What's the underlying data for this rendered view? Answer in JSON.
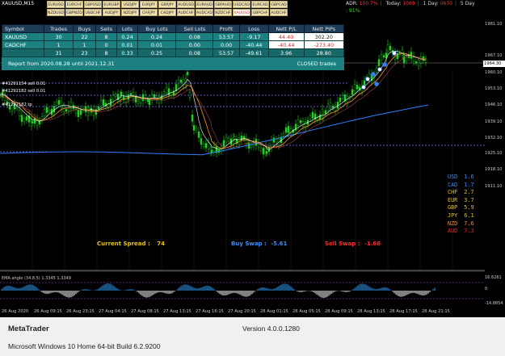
{
  "chart": {
    "symbol_title": "XAUUSD,M15",
    "pairs": [
      "EURUSD",
      "EURCHF",
      "GBPUSD",
      "EURGBP",
      "USDJPY",
      "EURJPY",
      "GBPJPY",
      "AUDUSD",
      "EURAUD",
      "GBPAUD",
      "USDCAD",
      "EURCAD",
      "GBPCAD",
      "NZDUSD",
      "GBPNZD",
      "USDCHF",
      "AUDJPY",
      "NZDJPY",
      "CHFJPY",
      "CADJPY",
      "AUDCHF",
      "AUDCAD",
      "NZDCHF",
      "XAUUSD",
      "GBPCHF",
      "AUDCHF"
    ],
    "active_pair": "XAUUSD",
    "adr": {
      "label": "ADR:",
      "value": "100.7%",
      "today_label": "Today:",
      "today": "1069",
      "day1_label": "1 Day:",
      "day1": "0670",
      "day5_label": "5 Day",
      "line2": ": 91%"
    },
    "table": {
      "headers": [
        "Symbol",
        "Trades",
        "Buys",
        "Sells",
        "Lots",
        "Buy Lots",
        "Sell Lots",
        "Profit",
        "Loss",
        "Nett P/L",
        "Nett PIPs"
      ],
      "rows": [
        [
          "XAUUSD",
          "30",
          "22",
          "8",
          "0.24",
          "0.24",
          "0.08",
          "53.57",
          "-9.17",
          "44.40",
          "302.20"
        ],
        [
          "CADCHF",
          "1",
          "1",
          "0",
          "0.01",
          "0.01",
          "0.00",
          "0.00",
          "-40.44",
          "-40.44",
          "-273.40"
        ],
        [
          "",
          "31",
          "23",
          "8",
          "0.33",
          "0.25",
          "0.08",
          "53.57",
          "-49.61",
          "3.96",
          "28.80"
        ]
      ]
    },
    "report": {
      "text": "Report from 2020.08.28 until 2021.12.31",
      "closed": "CLOSED trades"
    },
    "orders": [
      "#41291154 sell 0.01",
      "#41292182 sell 0.01",
      "#41292182 tp"
    ],
    "price_ticks": [
      "1981.10",
      "1967.10",
      "1960.10",
      "1953.10",
      "1946.10",
      "1939.10",
      "1932.10",
      "1925.10",
      "1918.10",
      "1911.10"
    ],
    "current_price": "1964.30",
    "currencies": [
      {
        "code": "USD",
        "value": "1.6",
        "color": "#3a8cff"
      },
      {
        "code": "CAD",
        "value": "1.7",
        "color": "#3a8cff"
      },
      {
        "code": "CHF",
        "value": "2.7",
        "color": "#e0c020"
      },
      {
        "code": "EUR",
        "value": "3.7",
        "color": "#e0c020"
      },
      {
        "code": "GBP",
        "value": "5.9",
        "color": "#e0c020"
      },
      {
        "code": "JPY",
        "value": "6.1",
        "color": "#e0c020"
      },
      {
        "code": "NZD",
        "value": "7.6",
        "color": "#ff8a2a"
      },
      {
        "code": "AUD",
        "value": "7.3",
        "color": "#ff2020"
      }
    ],
    "spread": {
      "label": "Current Spread :",
      "value": "74"
    },
    "buy_swap": {
      "label": "Buy Swap :",
      "value": "-5.61"
    },
    "sell_swap": {
      "label": "Sell Swap :",
      "value": "-1.66"
    },
    "indicator": {
      "label": "EMA angle (34,8,5) 1.3345 1.3349",
      "top": "16.6261",
      "bottom": "-14.8854",
      "zero": "0"
    },
    "time_ticks": [
      "26 Aug 2020",
      "26 Aug 09:15",
      "26 Aug 23:15",
      "27 Aug 04:15",
      "27 Aug 08:15",
      "27 Aug 13:15",
      "27 Aug 16:15",
      "27 Aug 20:15",
      "28 Aug 01:15",
      "28 Aug 05:15",
      "28 Aug 09:15",
      "28 Aug 13:15",
      "28 Aug 17:15",
      "28 Aug 21:15"
    ]
  },
  "about": {
    "app_name": "MetaTrader",
    "version": "Version 4.0.0.1280",
    "os": "Microsoft Windows 10 Home 64-bit Build 6.2.9200"
  }
}
